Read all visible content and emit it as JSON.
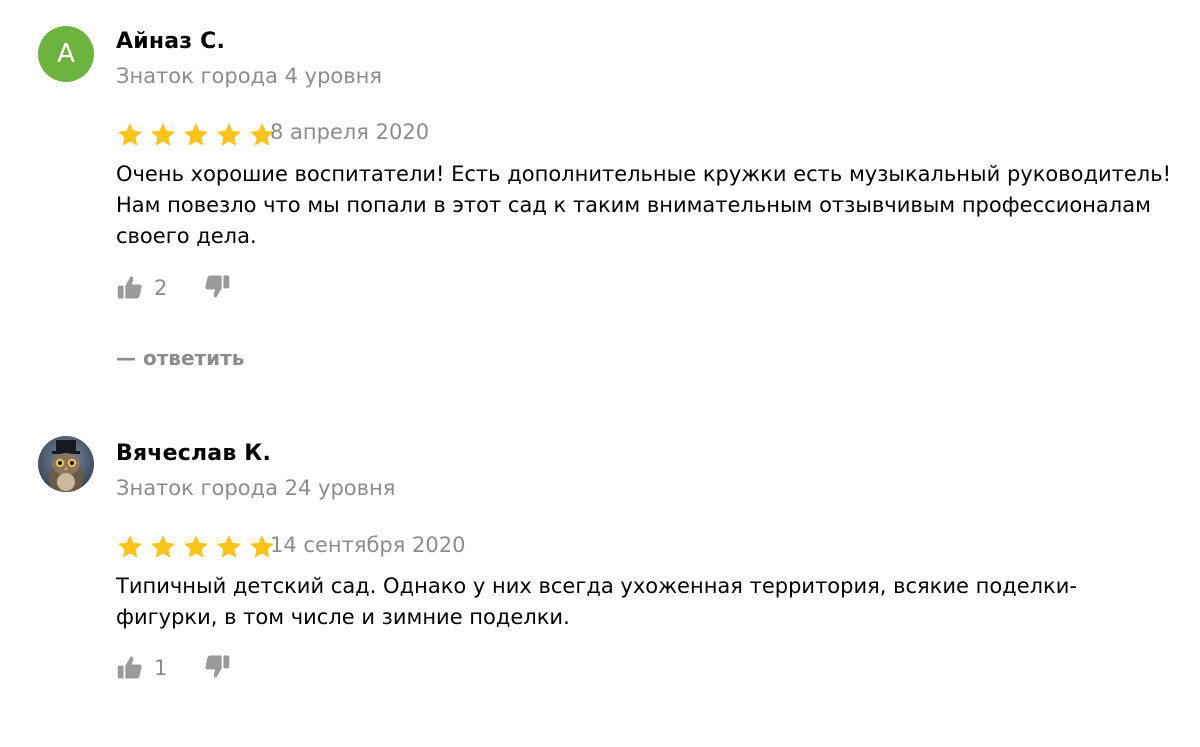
{
  "reviews": [
    {
      "avatar_letter": "А",
      "avatar_color": "#6db33f",
      "author": "Айназ С.",
      "level": "Знаток города 4 уровня",
      "rating": 5,
      "date": "8 апреля 2020",
      "text": "Очень хорошие воспитатели! Есть дополнительные кружки есть музыкальный руководитель! Нам повезло что мы попали в этот сад к таким внимательным отзывчивым профессионалам своего дела.",
      "likes": "2",
      "reply_label": "— ответить"
    },
    {
      "avatar_icon": "owl-avatar-icon",
      "author": "Вячеслав К.",
      "level": "Знаток города 24 уровня",
      "rating": 5,
      "date": "14 сентября 2020",
      "text": "Типичный детский сад. Однако у них всегда ухоженная территория, всякие поделки-фигурки, в том числе и зимние поделки.",
      "likes": "1"
    }
  ],
  "colors": {
    "star": "#fcc419",
    "muted": "#8c8c8c",
    "icon": "#9a9a9a"
  },
  "icons": {
    "like": "thumbs-up-icon",
    "dislike": "thumbs-down-icon",
    "star": "star-icon"
  }
}
